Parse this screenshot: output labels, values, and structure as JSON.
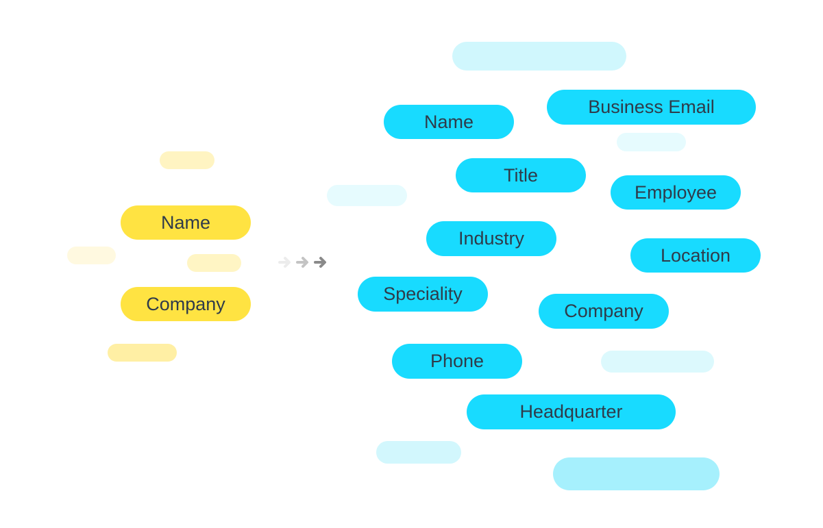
{
  "diagram": {
    "description": "Data enrichment illustration: few input fields transformed into many enriched fields",
    "input_fields": [
      {
        "label": "Name"
      },
      {
        "label": "Company"
      }
    ],
    "arrow": {
      "icon": "arrow-right-icon",
      "count": 3
    },
    "output_fields": [
      {
        "label": "Name"
      },
      {
        "label": "Business Email"
      },
      {
        "label": "Title"
      },
      {
        "label": "Employee"
      },
      {
        "label": "Industry"
      },
      {
        "label": "Location"
      },
      {
        "label": "Speciality"
      },
      {
        "label": "Company"
      },
      {
        "label": "Phone"
      },
      {
        "label": "Headquarter"
      }
    ],
    "colors": {
      "input_fill": "#ffe342",
      "output_fill": "#18dbff",
      "text": "#2f3b4a",
      "arrow_light": "#e8e8e8",
      "arrow_mid": "#c4c4c4",
      "arrow_dark": "#8a8a8a"
    }
  }
}
